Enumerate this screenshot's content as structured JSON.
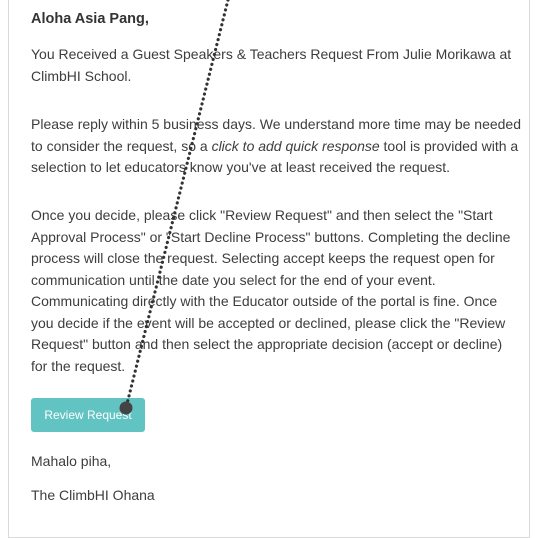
{
  "email": {
    "greeting": "Aloha Asia Pang,",
    "paragraph1": [
      "You Received a Guest Speakers & Teachers Request From Julie Morikawa at",
      "ClimbHI School."
    ],
    "paragraph2": {
      "line1": "Please reply within 5 business days. We understand more time may be needed",
      "line2_before": "to consider the request, so a ",
      "line2_italic": "click to add quick response",
      "line2_after": " tool is provided with a",
      "line3": "selection to let educators know you've at least received the request."
    },
    "paragraph3": [
      "Once you decide, please click \"Review Request\" and then select the \"Start",
      "Approval Process\" or \"Start Decline Process\" buttons. Completing the decline",
      "process will close the request. Selecting accept keeps the request open for",
      "communication until the date you select for the end of your event.",
      "Communicating directly with the Educator outside of the portal is fine. Once",
      "you decide if the event will be accepted or declined, please click the \"Review",
      "Request\" button and then select the appropriate decision (accept or decline)",
      "for the request."
    ],
    "button_label": "Review Request",
    "signoff": "Mahalo piha,",
    "signature": "The ClimbHI Ohana"
  },
  "colors": {
    "button": "#62c3c3",
    "text": "#3d3d3d",
    "annotation_line": "#333333"
  }
}
